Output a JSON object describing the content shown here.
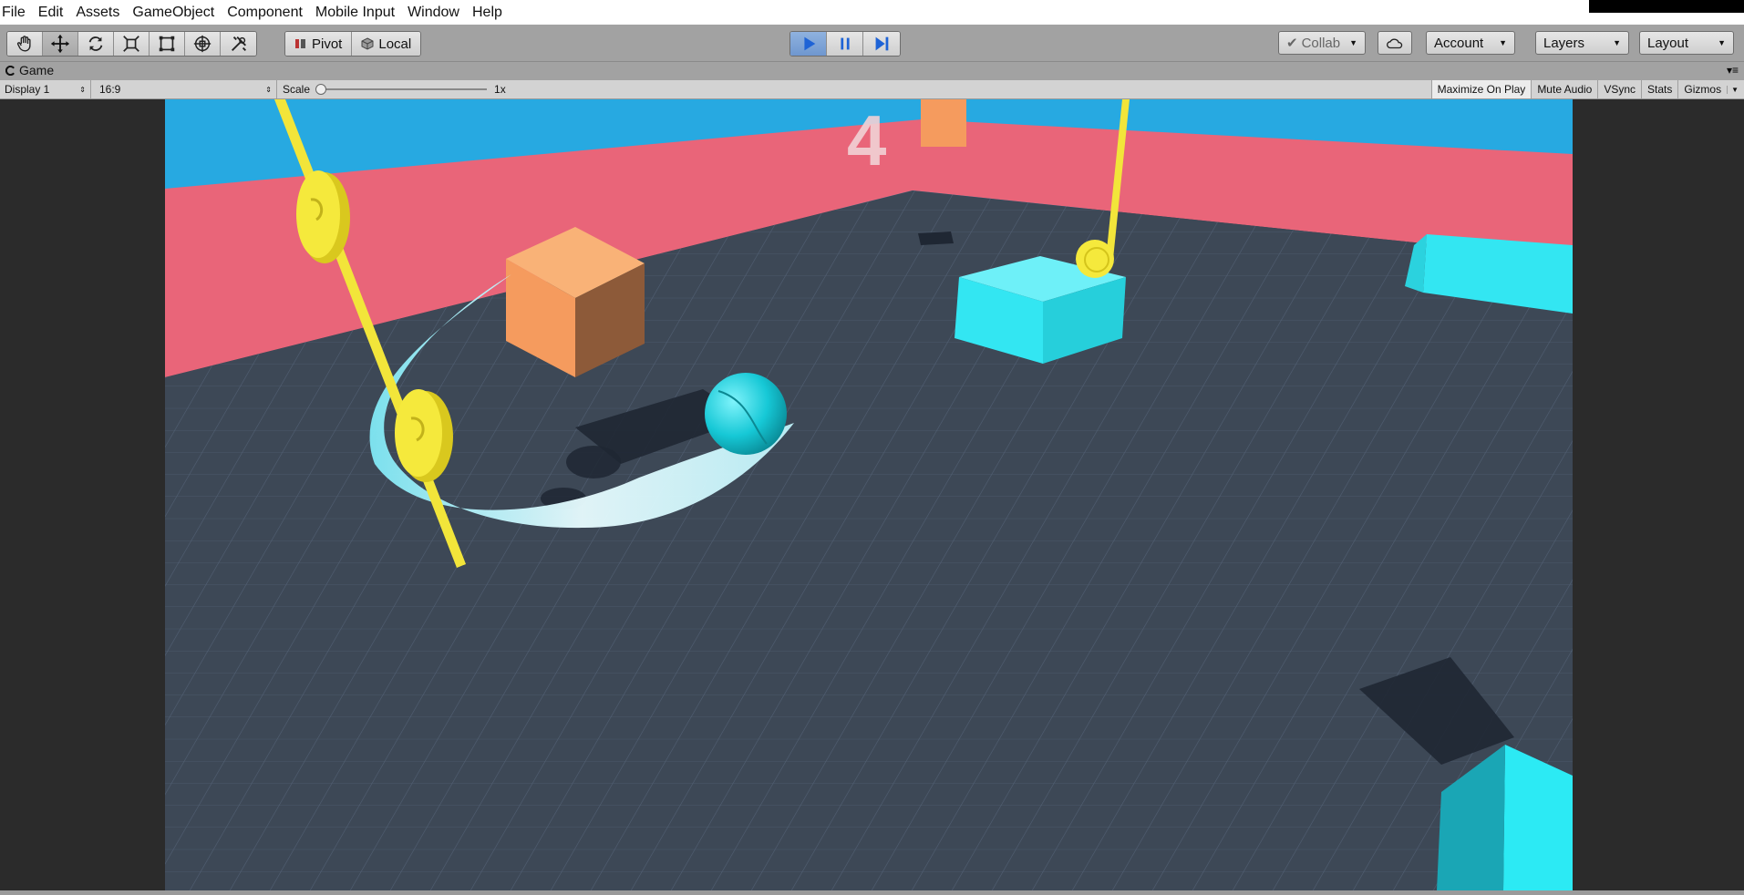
{
  "menu": [
    "File",
    "Edit",
    "Assets",
    "GameObject",
    "Component",
    "Mobile Input",
    "Window",
    "Help"
  ],
  "toolbar": {
    "transform_tools": [
      "hand-icon",
      "move-icon",
      "rotate-icon",
      "scale-icon",
      "rect-icon",
      "transform-icon",
      "custom-tool-icon"
    ],
    "pivot_label": "Pivot",
    "local_label": "Local",
    "play_controls": [
      "play-icon",
      "pause-icon",
      "step-icon"
    ],
    "collab_label": "Collab",
    "account_label": "Account",
    "layers_label": "Layers",
    "layout_label": "Layout"
  },
  "tab": {
    "label": "Game"
  },
  "gamebar": {
    "display": "Display 1",
    "aspect": "16:9",
    "scale_label": "Scale",
    "scale_value": "1x",
    "scale_fraction": 0.0,
    "toggles": [
      "Maximize On Play",
      "Mute Audio",
      "VSync",
      "Stats",
      "Gizmos"
    ]
  },
  "game": {
    "score": "4"
  },
  "colors": {
    "sky": "#27a9e1",
    "wall": "#e96579",
    "floor": "#3d4856",
    "coin": "#f2e53a",
    "cube_orange": "#f59b5e",
    "cube_cyan": "#33e6f2",
    "ball": "#16c8d6"
  }
}
